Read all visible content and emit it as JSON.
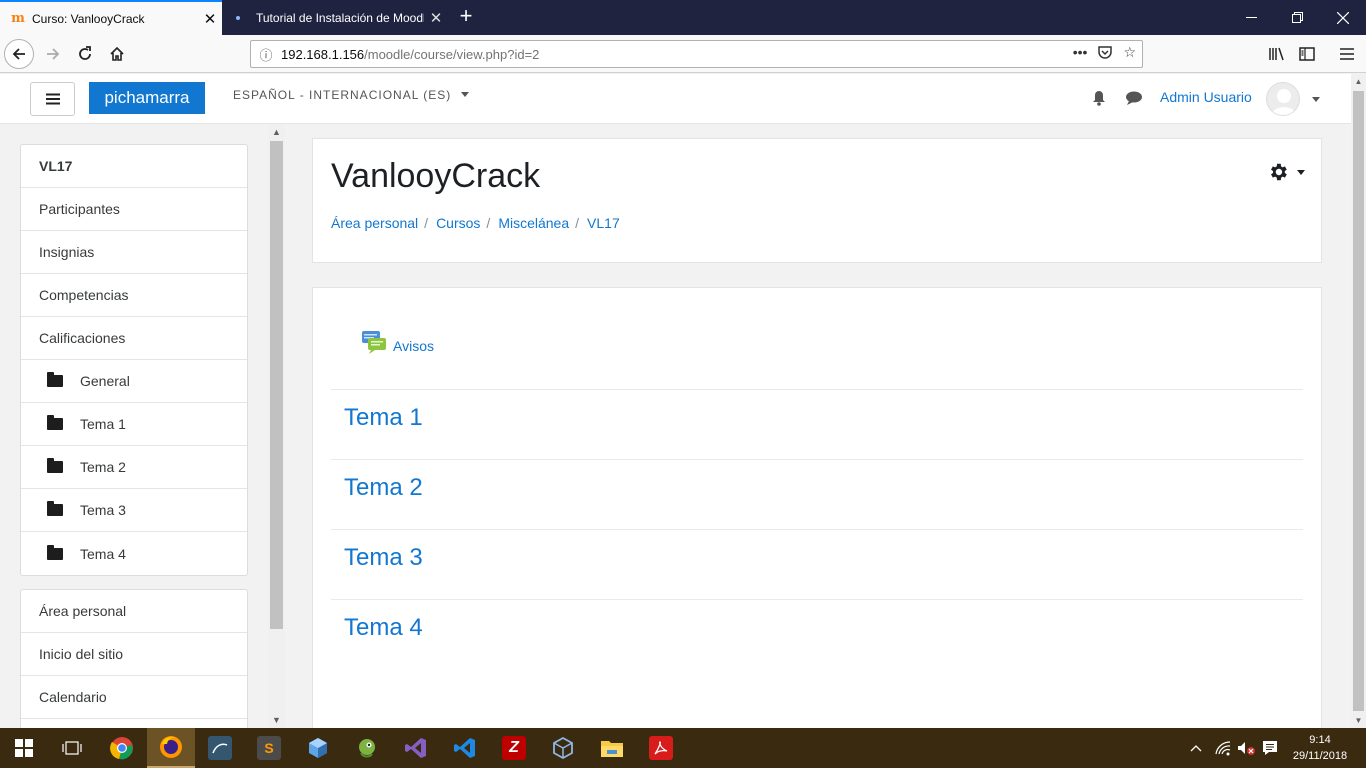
{
  "browser": {
    "tabs": [
      {
        "title": "Curso: VanlooyCrack",
        "active": true
      },
      {
        "title": "Tutorial de Instalación de Moodle",
        "active": false
      }
    ],
    "url_host": "192.168.1.156",
    "url_path": "/moodle/course/view.php?id=2"
  },
  "header": {
    "brand": "pichamarra",
    "language": "ESPAÑOL - INTERNACIONAL (ES)",
    "user_name": "Admin Usuario"
  },
  "drawer": {
    "course_nav": [
      {
        "label": "VL17",
        "type": "course"
      },
      {
        "label": "Participantes",
        "type": "link"
      },
      {
        "label": "Insignias",
        "type": "link"
      },
      {
        "label": "Competencias",
        "type": "link"
      },
      {
        "label": "Calificaciones",
        "type": "link"
      },
      {
        "label": "General",
        "type": "section"
      },
      {
        "label": "Tema 1",
        "type": "section"
      },
      {
        "label": "Tema 2",
        "type": "section"
      },
      {
        "label": "Tema 3",
        "type": "section"
      },
      {
        "label": "Tema 4",
        "type": "section"
      }
    ],
    "site_nav": [
      {
        "label": "Área personal"
      },
      {
        "label": "Inicio del sitio"
      },
      {
        "label": "Calendario"
      }
    ]
  },
  "page": {
    "title": "VanlooyCrack",
    "breadcrumb": [
      "Área personal",
      "Cursos",
      "Miscelánea",
      "VL17"
    ],
    "activity": "Avisos",
    "sections": [
      "Tema 1",
      "Tema 2",
      "Tema 3",
      "Tema 4"
    ]
  },
  "taskbar": {
    "time": "9:14",
    "date": "29/11/2018",
    "apps": [
      "start",
      "task-view",
      "chrome",
      "firefox",
      "mysql-workbench",
      "sublime-text",
      "virtualbox-box",
      "git-kraken",
      "visual-studio",
      "vscode",
      "filezilla",
      "virtualbox",
      "file-explorer",
      "acrobat"
    ]
  },
  "colors": {
    "accent": "#1177d1",
    "tabbar": "#202340",
    "taskbar": "#3a2a10"
  }
}
